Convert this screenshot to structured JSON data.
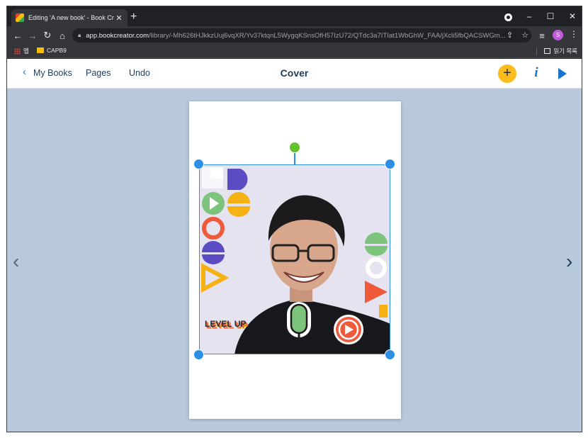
{
  "browser": {
    "tab": {
      "title": "Editing ‘A new book’ - Book Cr"
    },
    "address": {
      "host": "app.bookcreator.com",
      "path": "/library/-Mh626tHJkkzUuj6vqXR/Yv37ktqnL5WygqKSnsOfH57IzU72/QTdc3a7ITIat1WbGhW_FAA/jXcli5fbQACSWGm..."
    },
    "bookmarks": {
      "apps_label": "앱",
      "folder_label": "CAPB9",
      "reading_list_label": "읽기 목록"
    },
    "profile_initial": "S"
  },
  "app": {
    "nav": {
      "my_books": "My Books",
      "pages": "Pages",
      "undo": "Undo"
    },
    "title": "Cover",
    "sticker_text": "LEVEL UP"
  },
  "colors": {
    "selection": "#2d8ee6",
    "rotate_handle": "#62c32a",
    "add_button": "#fbbc1c",
    "app_background": "#b8c9dc",
    "accent_blue": "#1a73c9"
  }
}
